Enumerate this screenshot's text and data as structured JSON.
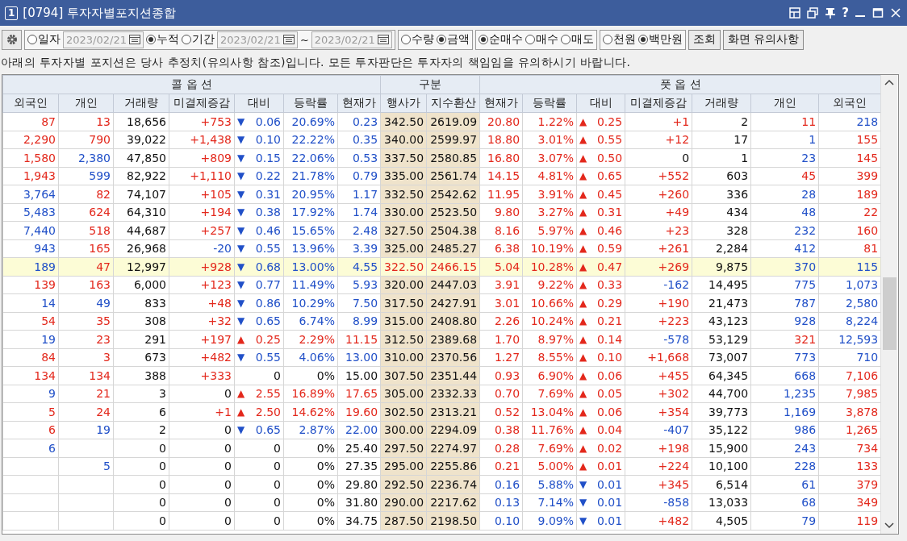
{
  "window": {
    "badge": "1",
    "title": "[0794] 투자자별포지션종합",
    "help": "?"
  },
  "toolbar": {
    "groups": [
      {
        "items": [
          {
            "kind": "radio",
            "label": "일자",
            "selected": false
          },
          {
            "kind": "date",
            "value": "2023/02/21",
            "disabled": true
          },
          {
            "kind": "radio",
            "label": "누적",
            "selected": true
          },
          {
            "kind": "radio",
            "label": "기간",
            "selected": false
          },
          {
            "kind": "date",
            "value": "2023/02/21",
            "disabled": true
          },
          {
            "kind": "text",
            "label": "~"
          },
          {
            "kind": "date",
            "value": "2023/02/21",
            "disabled": true
          }
        ]
      },
      {
        "items": [
          {
            "kind": "radio",
            "label": "수량",
            "selected": false
          },
          {
            "kind": "radio",
            "label": "금액",
            "selected": true
          }
        ]
      },
      {
        "items": [
          {
            "kind": "radio",
            "label": "순매수",
            "selected": true
          },
          {
            "kind": "radio",
            "label": "매수",
            "selected": false
          },
          {
            "kind": "radio",
            "label": "매도",
            "selected": false
          }
        ]
      },
      {
        "items": [
          {
            "kind": "radio",
            "label": "천원",
            "selected": false
          },
          {
            "kind": "radio",
            "label": "백만원",
            "selected": true
          }
        ]
      }
    ],
    "buttons": [
      "조회",
      "화면 유의사항"
    ]
  },
  "notice": "아래의 투자자별 포지션은 당사 추정치(유의사항 참조)입니다. 모든 투자판단은 투자자의 책임임을 유의하시기 바랍니다.",
  "table": {
    "groups": [
      "콜 옵 션",
      "구분",
      "풋 옵 션"
    ],
    "columns": [
      "외국인",
      "개인",
      "거래량",
      "미결제증감",
      "대비",
      "등락률",
      "현재가",
      "행사가",
      "지수환산",
      "현재가",
      "등락률",
      "대비",
      "미결제증감",
      "거래량",
      "개인",
      "외국인"
    ],
    "rows": [
      {
        "highlighted": false,
        "cells": [
          {
            "text": "87",
            "color": "#e3281c"
          },
          {
            "text": "13",
            "color": "#e3281c"
          },
          {
            "text": "18,656",
            "color": "#111111"
          },
          {
            "text": "+753",
            "color": "#e3281c"
          },
          {
            "sign": "▼",
            "text": "0.06",
            "color": "#2150c8"
          },
          {
            "text": "20.69%",
            "color": "#2150c8"
          },
          {
            "text": "0.23",
            "color": "#2150c8"
          },
          {
            "text": "342.50",
            "color": "#111111"
          },
          {
            "text": "2619.09",
            "color": "#111111"
          },
          {
            "text": "20.80",
            "color": "#e3281c"
          },
          {
            "text": "1.22%",
            "color": "#e3281c"
          },
          {
            "sign": "▲",
            "text": "0.25",
            "color": "#e3281c"
          },
          {
            "text": "+1",
            "color": "#e3281c"
          },
          {
            "text": "2",
            "color": "#111111"
          },
          {
            "text": "11",
            "color": "#e3281c"
          },
          {
            "text": "218",
            "color": "#2150c8"
          }
        ]
      },
      {
        "highlighted": false,
        "cells": [
          {
            "text": "2,290",
            "color": "#e3281c"
          },
          {
            "text": "790",
            "color": "#e3281c"
          },
          {
            "text": "39,022",
            "color": "#111111"
          },
          {
            "text": "+1,438",
            "color": "#e3281c"
          },
          {
            "sign": "▼",
            "text": "0.10",
            "color": "#2150c8"
          },
          {
            "text": "22.22%",
            "color": "#2150c8"
          },
          {
            "text": "0.35",
            "color": "#2150c8"
          },
          {
            "text": "340.00",
            "color": "#111111"
          },
          {
            "text": "2599.97",
            "color": "#111111"
          },
          {
            "text": "18.80",
            "color": "#e3281c"
          },
          {
            "text": "3.01%",
            "color": "#e3281c"
          },
          {
            "sign": "▲",
            "text": "0.55",
            "color": "#e3281c"
          },
          {
            "text": "+12",
            "color": "#e3281c"
          },
          {
            "text": "17",
            "color": "#111111"
          },
          {
            "text": "1",
            "color": "#2150c8"
          },
          {
            "text": "155",
            "color": "#e3281c"
          }
        ]
      },
      {
        "highlighted": false,
        "cells": [
          {
            "text": "1,580",
            "color": "#e3281c"
          },
          {
            "text": "2,380",
            "color": "#2150c8"
          },
          {
            "text": "47,850",
            "color": "#111111"
          },
          {
            "text": "+809",
            "color": "#e3281c"
          },
          {
            "sign": "▼",
            "text": "0.15",
            "color": "#2150c8"
          },
          {
            "text": "22.06%",
            "color": "#2150c8"
          },
          {
            "text": "0.53",
            "color": "#2150c8"
          },
          {
            "text": "337.50",
            "color": "#111111"
          },
          {
            "text": "2580.85",
            "color": "#111111"
          },
          {
            "text": "16.80",
            "color": "#e3281c"
          },
          {
            "text": "3.07%",
            "color": "#e3281c"
          },
          {
            "sign": "▲",
            "text": "0.50",
            "color": "#e3281c"
          },
          {
            "text": "0",
            "color": "#111111"
          },
          {
            "text": "1",
            "color": "#111111"
          },
          {
            "text": "23",
            "color": "#2150c8"
          },
          {
            "text": "145",
            "color": "#e3281c"
          }
        ]
      },
      {
        "highlighted": false,
        "cells": [
          {
            "text": "1,943",
            "color": "#e3281c"
          },
          {
            "text": "599",
            "color": "#2150c8"
          },
          {
            "text": "82,922",
            "color": "#111111"
          },
          {
            "text": "+1,110",
            "color": "#e3281c"
          },
          {
            "sign": "▼",
            "text": "0.22",
            "color": "#2150c8"
          },
          {
            "text": "21.78%",
            "color": "#2150c8"
          },
          {
            "text": "0.79",
            "color": "#2150c8"
          },
          {
            "text": "335.00",
            "color": "#111111"
          },
          {
            "text": "2561.74",
            "color": "#111111"
          },
          {
            "text": "14.15",
            "color": "#e3281c"
          },
          {
            "text": "4.81%",
            "color": "#e3281c"
          },
          {
            "sign": "▲",
            "text": "0.65",
            "color": "#e3281c"
          },
          {
            "text": "+552",
            "color": "#e3281c"
          },
          {
            "text": "603",
            "color": "#111111"
          },
          {
            "text": "45",
            "color": "#e3281c"
          },
          {
            "text": "399",
            "color": "#e3281c"
          }
        ]
      },
      {
        "highlighted": false,
        "cells": [
          {
            "text": "3,764",
            "color": "#2150c8"
          },
          {
            "text": "82",
            "color": "#e3281c"
          },
          {
            "text": "74,107",
            "color": "#111111"
          },
          {
            "text": "+105",
            "color": "#e3281c"
          },
          {
            "sign": "▼",
            "text": "0.31",
            "color": "#2150c8"
          },
          {
            "text": "20.95%",
            "color": "#2150c8"
          },
          {
            "text": "1.17",
            "color": "#2150c8"
          },
          {
            "text": "332.50",
            "color": "#111111"
          },
          {
            "text": "2542.62",
            "color": "#111111"
          },
          {
            "text": "11.95",
            "color": "#e3281c"
          },
          {
            "text": "3.91%",
            "color": "#e3281c"
          },
          {
            "sign": "▲",
            "text": "0.45",
            "color": "#e3281c"
          },
          {
            "text": "+260",
            "color": "#e3281c"
          },
          {
            "text": "336",
            "color": "#111111"
          },
          {
            "text": "28",
            "color": "#2150c8"
          },
          {
            "text": "189",
            "color": "#e3281c"
          }
        ]
      },
      {
        "highlighted": false,
        "cells": [
          {
            "text": "5,483",
            "color": "#2150c8"
          },
          {
            "text": "624",
            "color": "#e3281c"
          },
          {
            "text": "64,310",
            "color": "#111111"
          },
          {
            "text": "+194",
            "color": "#e3281c"
          },
          {
            "sign": "▼",
            "text": "0.38",
            "color": "#2150c8"
          },
          {
            "text": "17.92%",
            "color": "#2150c8"
          },
          {
            "text": "1.74",
            "color": "#2150c8"
          },
          {
            "text": "330.00",
            "color": "#111111"
          },
          {
            "text": "2523.50",
            "color": "#111111"
          },
          {
            "text": "9.80",
            "color": "#e3281c"
          },
          {
            "text": "3.27%",
            "color": "#e3281c"
          },
          {
            "sign": "▲",
            "text": "0.31",
            "color": "#e3281c"
          },
          {
            "text": "+49",
            "color": "#e3281c"
          },
          {
            "text": "434",
            "color": "#111111"
          },
          {
            "text": "48",
            "color": "#2150c8"
          },
          {
            "text": "22",
            "color": "#e3281c"
          }
        ]
      },
      {
        "highlighted": false,
        "cells": [
          {
            "text": "7,440",
            "color": "#2150c8"
          },
          {
            "text": "518",
            "color": "#e3281c"
          },
          {
            "text": "44,687",
            "color": "#111111"
          },
          {
            "text": "+257",
            "color": "#e3281c"
          },
          {
            "sign": "▼",
            "text": "0.46",
            "color": "#2150c8"
          },
          {
            "text": "15.65%",
            "color": "#2150c8"
          },
          {
            "text": "2.48",
            "color": "#2150c8"
          },
          {
            "text": "327.50",
            "color": "#111111"
          },
          {
            "text": "2504.38",
            "color": "#111111"
          },
          {
            "text": "8.16",
            "color": "#e3281c"
          },
          {
            "text": "5.97%",
            "color": "#e3281c"
          },
          {
            "sign": "▲",
            "text": "0.46",
            "color": "#e3281c"
          },
          {
            "text": "+23",
            "color": "#e3281c"
          },
          {
            "text": "328",
            "color": "#111111"
          },
          {
            "text": "232",
            "color": "#2150c8"
          },
          {
            "text": "160",
            "color": "#e3281c"
          }
        ]
      },
      {
        "highlighted": false,
        "cells": [
          {
            "text": "943",
            "color": "#2150c8"
          },
          {
            "text": "165",
            "color": "#e3281c"
          },
          {
            "text": "26,968",
            "color": "#111111"
          },
          {
            "text": "-20",
            "color": "#2150c8"
          },
          {
            "sign": "▼",
            "text": "0.55",
            "color": "#2150c8"
          },
          {
            "text": "13.96%",
            "color": "#2150c8"
          },
          {
            "text": "3.39",
            "color": "#2150c8"
          },
          {
            "text": "325.00",
            "color": "#111111"
          },
          {
            "text": "2485.27",
            "color": "#111111"
          },
          {
            "text": "6.38",
            "color": "#e3281c"
          },
          {
            "text": "10.19%",
            "color": "#e3281c"
          },
          {
            "sign": "▲",
            "text": "0.59",
            "color": "#e3281c"
          },
          {
            "text": "+261",
            "color": "#e3281c"
          },
          {
            "text": "2,284",
            "color": "#111111"
          },
          {
            "text": "412",
            "color": "#2150c8"
          },
          {
            "text": "81",
            "color": "#e3281c"
          }
        ]
      },
      {
        "highlighted": true,
        "cells": [
          {
            "text": "189",
            "color": "#2150c8"
          },
          {
            "text": "47",
            "color": "#e3281c"
          },
          {
            "text": "12,997",
            "color": "#111111"
          },
          {
            "text": "+928",
            "color": "#e3281c"
          },
          {
            "sign": "▼",
            "text": "0.68",
            "color": "#2150c8"
          },
          {
            "text": "13.00%",
            "color": "#2150c8"
          },
          {
            "text": "4.55",
            "color": "#2150c8"
          },
          {
            "text": "322.50",
            "color": "#e3281c"
          },
          {
            "text": "2466.15",
            "color": "#e3281c"
          },
          {
            "text": "5.04",
            "color": "#e3281c"
          },
          {
            "text": "10.28%",
            "color": "#e3281c"
          },
          {
            "sign": "▲",
            "text": "0.47",
            "color": "#e3281c"
          },
          {
            "text": "+269",
            "color": "#e3281c"
          },
          {
            "text": "9,875",
            "color": "#111111"
          },
          {
            "text": "370",
            "color": "#2150c8"
          },
          {
            "text": "115",
            "color": "#2150c8"
          }
        ]
      },
      {
        "highlighted": false,
        "cells": [
          {
            "text": "139",
            "color": "#e3281c"
          },
          {
            "text": "163",
            "color": "#e3281c"
          },
          {
            "text": "6,000",
            "color": "#111111"
          },
          {
            "text": "+123",
            "color": "#e3281c"
          },
          {
            "sign": "▼",
            "text": "0.77",
            "color": "#2150c8"
          },
          {
            "text": "11.49%",
            "color": "#2150c8"
          },
          {
            "text": "5.93",
            "color": "#2150c8"
          },
          {
            "text": "320.00",
            "color": "#111111"
          },
          {
            "text": "2447.03",
            "color": "#111111"
          },
          {
            "text": "3.91",
            "color": "#e3281c"
          },
          {
            "text": "9.22%",
            "color": "#e3281c"
          },
          {
            "sign": "▲",
            "text": "0.33",
            "color": "#e3281c"
          },
          {
            "text": "-162",
            "color": "#2150c8"
          },
          {
            "text": "14,495",
            "color": "#111111"
          },
          {
            "text": "775",
            "color": "#2150c8"
          },
          {
            "text": "1,073",
            "color": "#2150c8"
          }
        ]
      },
      {
        "highlighted": false,
        "cells": [
          {
            "text": "14",
            "color": "#2150c8"
          },
          {
            "text": "49",
            "color": "#2150c8"
          },
          {
            "text": "833",
            "color": "#111111"
          },
          {
            "text": "+48",
            "color": "#e3281c"
          },
          {
            "sign": "▼",
            "text": "0.86",
            "color": "#2150c8"
          },
          {
            "text": "10.29%",
            "color": "#2150c8"
          },
          {
            "text": "7.50",
            "color": "#2150c8"
          },
          {
            "text": "317.50",
            "color": "#111111"
          },
          {
            "text": "2427.91",
            "color": "#111111"
          },
          {
            "text": "3.01",
            "color": "#e3281c"
          },
          {
            "text": "10.66%",
            "color": "#e3281c"
          },
          {
            "sign": "▲",
            "text": "0.29",
            "color": "#e3281c"
          },
          {
            "text": "+190",
            "color": "#e3281c"
          },
          {
            "text": "21,473",
            "color": "#111111"
          },
          {
            "text": "787",
            "color": "#2150c8"
          },
          {
            "text": "2,580",
            "color": "#2150c8"
          }
        ]
      },
      {
        "highlighted": false,
        "cells": [
          {
            "text": "54",
            "color": "#e3281c"
          },
          {
            "text": "35",
            "color": "#e3281c"
          },
          {
            "text": "308",
            "color": "#111111"
          },
          {
            "text": "+32",
            "color": "#e3281c"
          },
          {
            "sign": "▼",
            "text": "0.65",
            "color": "#2150c8"
          },
          {
            "text": "6.74%",
            "color": "#2150c8"
          },
          {
            "text": "8.99",
            "color": "#2150c8"
          },
          {
            "text": "315.00",
            "color": "#111111"
          },
          {
            "text": "2408.80",
            "color": "#111111"
          },
          {
            "text": "2.26",
            "color": "#e3281c"
          },
          {
            "text": "10.24%",
            "color": "#e3281c"
          },
          {
            "sign": "▲",
            "text": "0.21",
            "color": "#e3281c"
          },
          {
            "text": "+223",
            "color": "#e3281c"
          },
          {
            "text": "43,123",
            "color": "#111111"
          },
          {
            "text": "928",
            "color": "#2150c8"
          },
          {
            "text": "8,224",
            "color": "#2150c8"
          }
        ]
      },
      {
        "highlighted": false,
        "cells": [
          {
            "text": "19",
            "color": "#2150c8"
          },
          {
            "text": "23",
            "color": "#e3281c"
          },
          {
            "text": "291",
            "color": "#111111"
          },
          {
            "text": "+197",
            "color": "#e3281c"
          },
          {
            "sign": "▲",
            "text": "0.25",
            "color": "#e3281c"
          },
          {
            "text": "2.29%",
            "color": "#e3281c"
          },
          {
            "text": "11.15",
            "color": "#e3281c"
          },
          {
            "text": "312.50",
            "color": "#111111"
          },
          {
            "text": "2389.68",
            "color": "#111111"
          },
          {
            "text": "1.70",
            "color": "#e3281c"
          },
          {
            "text": "8.97%",
            "color": "#e3281c"
          },
          {
            "sign": "▲",
            "text": "0.14",
            "color": "#e3281c"
          },
          {
            "text": "-578",
            "color": "#2150c8"
          },
          {
            "text": "53,129",
            "color": "#111111"
          },
          {
            "text": "321",
            "color": "#e3281c"
          },
          {
            "text": "12,593",
            "color": "#2150c8"
          }
        ]
      },
      {
        "highlighted": false,
        "cells": [
          {
            "text": "84",
            "color": "#e3281c"
          },
          {
            "text": "3",
            "color": "#e3281c"
          },
          {
            "text": "673",
            "color": "#111111"
          },
          {
            "text": "+482",
            "color": "#e3281c"
          },
          {
            "sign": "▼",
            "text": "0.55",
            "color": "#2150c8"
          },
          {
            "text": "4.06%",
            "color": "#2150c8"
          },
          {
            "text": "13.00",
            "color": "#2150c8"
          },
          {
            "text": "310.00",
            "color": "#111111"
          },
          {
            "text": "2370.56",
            "color": "#111111"
          },
          {
            "text": "1.27",
            "color": "#e3281c"
          },
          {
            "text": "8.55%",
            "color": "#e3281c"
          },
          {
            "sign": "▲",
            "text": "0.10",
            "color": "#e3281c"
          },
          {
            "text": "+1,668",
            "color": "#e3281c"
          },
          {
            "text": "73,007",
            "color": "#111111"
          },
          {
            "text": "773",
            "color": "#2150c8"
          },
          {
            "text": "710",
            "color": "#2150c8"
          }
        ]
      },
      {
        "highlighted": false,
        "cells": [
          {
            "text": "134",
            "color": "#e3281c"
          },
          {
            "text": "134",
            "color": "#e3281c"
          },
          {
            "text": "388",
            "color": "#111111"
          },
          {
            "text": "+333",
            "color": "#e3281c"
          },
          {
            "text": "0",
            "color": "#111111"
          },
          {
            "text": "0%",
            "color": "#111111"
          },
          {
            "text": "15.00",
            "color": "#111111"
          },
          {
            "text": "307.50",
            "color": "#111111"
          },
          {
            "text": "2351.44",
            "color": "#111111"
          },
          {
            "text": "0.93",
            "color": "#e3281c"
          },
          {
            "text": "6.90%",
            "color": "#e3281c"
          },
          {
            "sign": "▲",
            "text": "0.06",
            "color": "#e3281c"
          },
          {
            "text": "+455",
            "color": "#e3281c"
          },
          {
            "text": "64,345",
            "color": "#111111"
          },
          {
            "text": "668",
            "color": "#2150c8"
          },
          {
            "text": "7,106",
            "color": "#e3281c"
          }
        ]
      },
      {
        "highlighted": false,
        "cells": [
          {
            "text": "9",
            "color": "#2150c8"
          },
          {
            "text": "21",
            "color": "#e3281c"
          },
          {
            "text": "3",
            "color": "#111111"
          },
          {
            "text": "0",
            "color": "#111111"
          },
          {
            "sign": "▲",
            "text": "2.55",
            "color": "#e3281c"
          },
          {
            "text": "16.89%",
            "color": "#e3281c"
          },
          {
            "text": "17.65",
            "color": "#e3281c"
          },
          {
            "text": "305.00",
            "color": "#111111"
          },
          {
            "text": "2332.33",
            "color": "#111111"
          },
          {
            "text": "0.70",
            "color": "#e3281c"
          },
          {
            "text": "7.69%",
            "color": "#e3281c"
          },
          {
            "sign": "▲",
            "text": "0.05",
            "color": "#e3281c"
          },
          {
            "text": "+302",
            "color": "#e3281c"
          },
          {
            "text": "44,700",
            "color": "#111111"
          },
          {
            "text": "1,235",
            "color": "#2150c8"
          },
          {
            "text": "7,985",
            "color": "#e3281c"
          }
        ]
      },
      {
        "highlighted": false,
        "cells": [
          {
            "text": "5",
            "color": "#e3281c"
          },
          {
            "text": "24",
            "color": "#e3281c"
          },
          {
            "text": "6",
            "color": "#111111"
          },
          {
            "text": "+1",
            "color": "#e3281c"
          },
          {
            "sign": "▲",
            "text": "2.50",
            "color": "#e3281c"
          },
          {
            "text": "14.62%",
            "color": "#e3281c"
          },
          {
            "text": "19.60",
            "color": "#e3281c"
          },
          {
            "text": "302.50",
            "color": "#111111"
          },
          {
            "text": "2313.21",
            "color": "#111111"
          },
          {
            "text": "0.52",
            "color": "#e3281c"
          },
          {
            "text": "13.04%",
            "color": "#e3281c"
          },
          {
            "sign": "▲",
            "text": "0.06",
            "color": "#e3281c"
          },
          {
            "text": "+354",
            "color": "#e3281c"
          },
          {
            "text": "39,773",
            "color": "#111111"
          },
          {
            "text": "1,169",
            "color": "#2150c8"
          },
          {
            "text": "3,878",
            "color": "#e3281c"
          }
        ]
      },
      {
        "highlighted": false,
        "cells": [
          {
            "text": "6",
            "color": "#e3281c"
          },
          {
            "text": "19",
            "color": "#2150c8"
          },
          {
            "text": "2",
            "color": "#111111"
          },
          {
            "text": "0",
            "color": "#111111"
          },
          {
            "sign": "▼",
            "text": "0.65",
            "color": "#2150c8"
          },
          {
            "text": "2.87%",
            "color": "#2150c8"
          },
          {
            "text": "22.00",
            "color": "#2150c8"
          },
          {
            "text": "300.00",
            "color": "#111111"
          },
          {
            "text": "2294.09",
            "color": "#111111"
          },
          {
            "text": "0.38",
            "color": "#e3281c"
          },
          {
            "text": "11.76%",
            "color": "#e3281c"
          },
          {
            "sign": "▲",
            "text": "0.04",
            "color": "#e3281c"
          },
          {
            "text": "-407",
            "color": "#2150c8"
          },
          {
            "text": "35,122",
            "color": "#111111"
          },
          {
            "text": "986",
            "color": "#2150c8"
          },
          {
            "text": "1,265",
            "color": "#e3281c"
          }
        ]
      },
      {
        "highlighted": false,
        "cells": [
          {
            "text": "6",
            "color": "#2150c8"
          },
          null,
          {
            "text": "0",
            "color": "#111111"
          },
          {
            "text": "0",
            "color": "#111111"
          },
          {
            "text": "0",
            "color": "#111111"
          },
          {
            "text": "0%",
            "color": "#111111"
          },
          {
            "text": "25.40",
            "color": "#111111"
          },
          {
            "text": "297.50",
            "color": "#111111"
          },
          {
            "text": "2274.97",
            "color": "#111111"
          },
          {
            "text": "0.28",
            "color": "#e3281c"
          },
          {
            "text": "7.69%",
            "color": "#e3281c"
          },
          {
            "sign": "▲",
            "text": "0.02",
            "color": "#e3281c"
          },
          {
            "text": "+198",
            "color": "#e3281c"
          },
          {
            "text": "15,900",
            "color": "#111111"
          },
          {
            "text": "243",
            "color": "#2150c8"
          },
          {
            "text": "734",
            "color": "#e3281c"
          }
        ]
      },
      {
        "highlighted": false,
        "cells": [
          null,
          {
            "text": "5",
            "color": "#2150c8"
          },
          {
            "text": "0",
            "color": "#111111"
          },
          {
            "text": "0",
            "color": "#111111"
          },
          {
            "text": "0",
            "color": "#111111"
          },
          {
            "text": "0%",
            "color": "#111111"
          },
          {
            "text": "27.35",
            "color": "#111111"
          },
          {
            "text": "295.00",
            "color": "#111111"
          },
          {
            "text": "2255.86",
            "color": "#111111"
          },
          {
            "text": "0.21",
            "color": "#e3281c"
          },
          {
            "text": "5.00%",
            "color": "#e3281c"
          },
          {
            "sign": "▲",
            "text": "0.01",
            "color": "#e3281c"
          },
          {
            "text": "+224",
            "color": "#e3281c"
          },
          {
            "text": "10,100",
            "color": "#111111"
          },
          {
            "text": "228",
            "color": "#2150c8"
          },
          {
            "text": "133",
            "color": "#e3281c"
          }
        ]
      },
      {
        "highlighted": false,
        "cells": [
          null,
          null,
          {
            "text": "0",
            "color": "#111111"
          },
          {
            "text": "0",
            "color": "#111111"
          },
          {
            "text": "0",
            "color": "#111111"
          },
          {
            "text": "0%",
            "color": "#111111"
          },
          {
            "text": "29.80",
            "color": "#111111"
          },
          {
            "text": "292.50",
            "color": "#111111"
          },
          {
            "text": "2236.74",
            "color": "#111111"
          },
          {
            "text": "0.16",
            "color": "#2150c8"
          },
          {
            "text": "5.88%",
            "color": "#2150c8"
          },
          {
            "sign": "▼",
            "text": "0.01",
            "color": "#2150c8"
          },
          {
            "text": "+345",
            "color": "#e3281c"
          },
          {
            "text": "6,514",
            "color": "#111111"
          },
          {
            "text": "61",
            "color": "#2150c8"
          },
          {
            "text": "379",
            "color": "#e3281c"
          }
        ]
      },
      {
        "highlighted": false,
        "cells": [
          null,
          null,
          {
            "text": "0",
            "color": "#111111"
          },
          {
            "text": "0",
            "color": "#111111"
          },
          {
            "text": "0",
            "color": "#111111"
          },
          {
            "text": "0%",
            "color": "#111111"
          },
          {
            "text": "31.80",
            "color": "#111111"
          },
          {
            "text": "290.00",
            "color": "#111111"
          },
          {
            "text": "2217.62",
            "color": "#111111"
          },
          {
            "text": "0.13",
            "color": "#2150c8"
          },
          {
            "text": "7.14%",
            "color": "#2150c8"
          },
          {
            "sign": "▼",
            "text": "0.01",
            "color": "#2150c8"
          },
          {
            "text": "-858",
            "color": "#2150c8"
          },
          {
            "text": "13,033",
            "color": "#111111"
          },
          {
            "text": "68",
            "color": "#2150c8"
          },
          {
            "text": "349",
            "color": "#e3281c"
          }
        ]
      },
      {
        "highlighted": false,
        "cells": [
          null,
          null,
          {
            "text": "0",
            "color": "#111111"
          },
          {
            "text": "0",
            "color": "#111111"
          },
          {
            "text": "0",
            "color": "#111111"
          },
          {
            "text": "0%",
            "color": "#111111"
          },
          {
            "text": "34.75",
            "color": "#111111"
          },
          {
            "text": "287.50",
            "color": "#111111"
          },
          {
            "text": "2198.50",
            "color": "#111111"
          },
          {
            "text": "0.10",
            "color": "#2150c8"
          },
          {
            "text": "9.09%",
            "color": "#2150c8"
          },
          {
            "sign": "▼",
            "text": "0.01",
            "color": "#2150c8"
          },
          {
            "text": "+482",
            "color": "#e3281c"
          },
          {
            "text": "4,505",
            "color": "#111111"
          },
          {
            "text": "79",
            "color": "#2150c8"
          },
          {
            "text": "119",
            "color": "#e3281c"
          }
        ]
      }
    ]
  }
}
